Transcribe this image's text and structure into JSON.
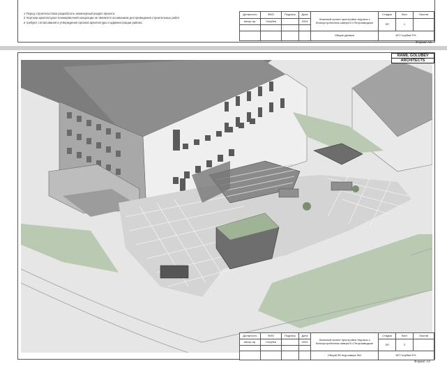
{
  "sheet1": {
    "notes": [
      "1        Перед строительством разработать инженерный раздел проекта.",
      "2        Чертежи архитектурно-планировочной концепции не являются основанием для проведения строительных работ",
      "и требуют согласования и утверждения органов архитектуры и администрации района."
    ],
    "stamp": {
      "h_position": "Должность",
      "h_name": "ФИО",
      "h_sign": "Подпись",
      "h_date": "Дата",
      "r_position": "Автор пр.",
      "r_name": "Голубев",
      "r_date": "2024",
      "project": "Эскизный проект пристройки террасы с благоустройством сквера В г.Петрозаводске",
      "h_stage": "Стадия",
      "h_sheet": "Лист",
      "h_sheets": "Листов",
      "stage": "ЭП",
      "sheet": "1",
      "title": "Общие данные",
      "author": "ИП Голубев Р.Н."
    },
    "format": "Формат А3"
  },
  "sheet2": {
    "logo": {
      "line1": "RAMIL GOLUBEV",
      "line2": "ARCHITECTS"
    },
    "stamp": {
      "h_position": "Должность",
      "h_name": "ФИО",
      "h_sign": "Подпись",
      "h_date": "Дата",
      "r_position": "Автор пр.",
      "r_name": "Голубев",
      "r_date": "2024",
      "project": "Эскизный проект пристройки террасы с благоустройством сквера В г.Петрозаводске",
      "h_stage": "Стадия",
      "h_sheet": "Лист",
      "h_sheets": "Листов",
      "stage": "ЭП",
      "sheet": "2",
      "title": "Общий 3D вид сквера №1",
      "author": "ИП Голубев Р.Н."
    },
    "format": "Формат А3"
  },
  "colors": {
    "grass": "#b9c9b2",
    "paving": "#d2d2d2",
    "building": "#ececec",
    "shadow": "#8a8a8a",
    "road": "#e8e8e8"
  }
}
